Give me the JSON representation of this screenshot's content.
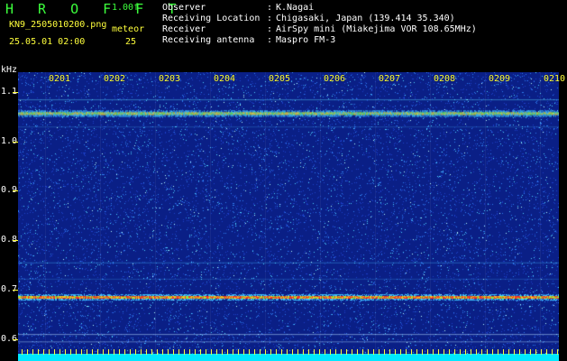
{
  "header": {
    "app_logo": "H R O F F T",
    "version": "1.00f",
    "file_name": "KN9_2505010200.png",
    "meteor_label": "meteor",
    "meteor_count": "25",
    "datetime": "25.05.01 02:00"
  },
  "info": [
    {
      "label": "Observer",
      "value": "K.Nagai"
    },
    {
      "label": "Receiving Location",
      "value": "Chigasaki, Japan (139.414 35.340)"
    },
    {
      "label": "Receiver",
      "value": "AirSpy mini (Miakejima VOR 108.65MHz)"
    },
    {
      "label": "Receiving antenna",
      "value": "Maspro FM-3"
    }
  ],
  "spectrogram": {
    "y_unit": "kHz",
    "y_ticks": [
      "1.1",
      "1.0",
      "0.9",
      "0.8",
      "0.7",
      "0.6"
    ],
    "y_range": [
      0.57,
      1.14
    ],
    "x_ticks": [
      "0201",
      "0202",
      "0203",
      "0204",
      "0205",
      "0206",
      "0207",
      "0208",
      "0209",
      "0210"
    ],
    "signal_lines_khz": [
      1.057,
      0.685
    ]
  },
  "colors": {
    "background": "#0a1f86",
    "header_green": "#3cff3c",
    "header_yellow": "#ffff3c",
    "baseline_cyan": "#00e8ff"
  }
}
